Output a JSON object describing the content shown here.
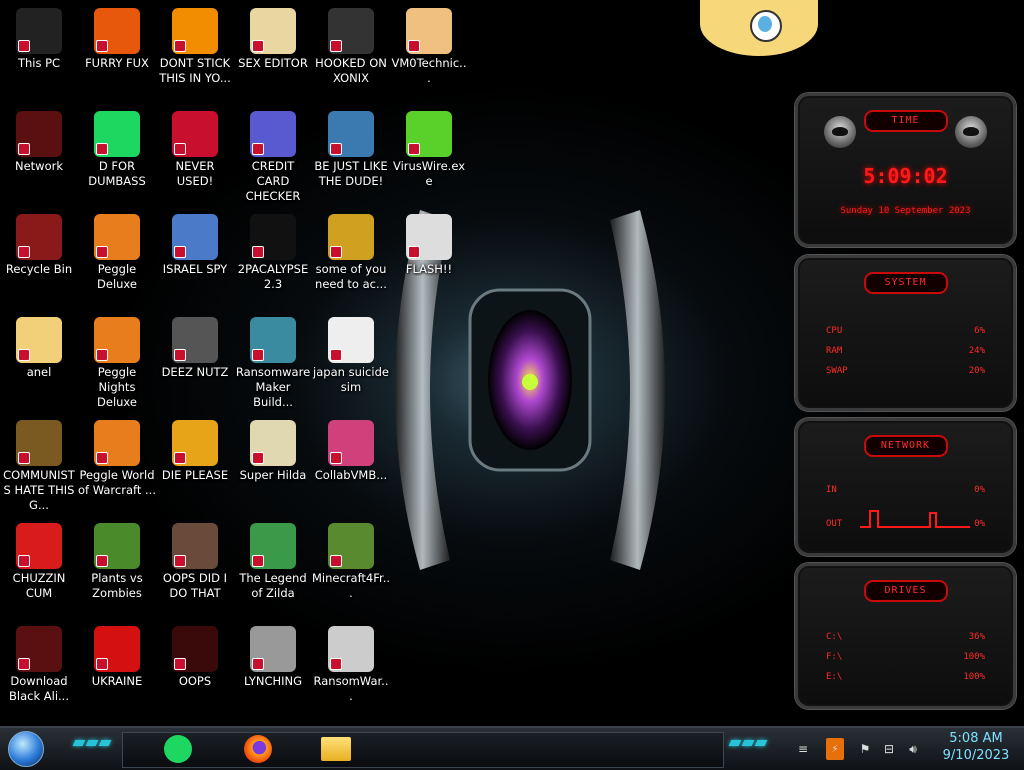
{
  "desktop": {
    "icons": [
      {
        "label": "This PC",
        "icon": "computer-icon",
        "color": "#222"
      },
      {
        "label": "Network",
        "icon": "alien-head-icon",
        "color": "#5a1010"
      },
      {
        "label": "Recycle Bin",
        "icon": "recycle-bin-icon",
        "color": "#8a1a1a"
      },
      {
        "label": "anel",
        "icon": "cartoon-girl-icon",
        "color": "#f2d07a"
      },
      {
        "label": "COMMUNISTS HATE THIS G...",
        "icon": "money-bag-icon",
        "color": "#7a5a20"
      },
      {
        "label": "CHUZZIN CUM",
        "icon": "red-furball-icon",
        "color": "#d81b1b"
      },
      {
        "label": "Download Black Ali...",
        "icon": "alien-head-icon",
        "color": "#5a1010"
      },
      {
        "label": "FURRY FUX",
        "icon": "firefox-icon",
        "color": "#e8580c"
      },
      {
        "label": "D FOR DUMBASS",
        "icon": "spotify-icon",
        "color": "#1ed760"
      },
      {
        "label": "Peggle Deluxe",
        "icon": "peggle-icon",
        "color": "#e87d1e"
      },
      {
        "label": "Peggle Nights Deluxe",
        "icon": "peggle-icon",
        "color": "#e87d1e"
      },
      {
        "label": "Peggle World of Warcraft ...",
        "icon": "peggle-icon",
        "color": "#e87d1e"
      },
      {
        "label": "Plants vs Zombies",
        "icon": "flower-pot-icon",
        "color": "#4a8a2a"
      },
      {
        "label": "UKRAINE",
        "icon": "radiation-icon",
        "color": "#d41010"
      },
      {
        "label": "DONT STICK THIS IN YO...",
        "icon": "traffic-cone-icon",
        "color": "#f28c00"
      },
      {
        "label": "NEVER USED!",
        "icon": "dev-cpp-icon",
        "color": "#c8102e"
      },
      {
        "label": "ISRAEL SPY",
        "icon": "network-pc-icon",
        "color": "#4a7ac8"
      },
      {
        "label": "DEEZ NUTZ",
        "icon": "stacked-windows-icon",
        "color": "#555"
      },
      {
        "label": "DIE PLEASE",
        "icon": "de-letters-icon",
        "color": "#e8a418"
      },
      {
        "label": "OOPS DID I DO THAT",
        "icon": "portrait-icon",
        "color": "#6a4a3a"
      },
      {
        "label": "OOPS",
        "icon": "alien-laptop-icon",
        "color": "#3a0a0a"
      },
      {
        "label": "SEX EDITOR",
        "icon": "hxd-icon",
        "color": "#e8d7a0"
      },
      {
        "label": "CREDIT CARD CHECKER",
        "icon": "credit-card-icon",
        "color": "#5a5ad0"
      },
      {
        "label": "2PACALYPSE 2.3",
        "icon": "terminal-icon",
        "color": "#111"
      },
      {
        "label": "Ransomware Maker Build...",
        "icon": "window-app-icon",
        "color": "#3a8aa0"
      },
      {
        "label": "Super Hilda",
        "icon": "pixel-dog-icon",
        "color": "#e0d8b0"
      },
      {
        "label": "The Legend of Zilda",
        "icon": "pixel-hero-icon",
        "color": "#3a9a4a"
      },
      {
        "label": "LYNCHING",
        "icon": "gear-flag-icon",
        "color": "#999"
      },
      {
        "label": "HOOKED ON XONIX",
        "icon": "maze-icon",
        "color": "#333"
      },
      {
        "label": "BE JUST LIKE THE DUDE!",
        "icon": "dwarf-icon",
        "color": "#3a7ab0"
      },
      {
        "label": "some of you need to ac...",
        "icon": "bear-icon",
        "color": "#d0a020"
      },
      {
        "label": "japan suicide sim",
        "icon": "document-icon",
        "color": "#eee"
      },
      {
        "label": "CollabVMB...",
        "icon": "pink-monitor-icon",
        "color": "#d0407a"
      },
      {
        "label": "Minecraft4Fr...",
        "icon": "grass-block-icon",
        "color": "#5a8a30"
      },
      {
        "label": "RansomWar...",
        "icon": "skull-ring-icon",
        "color": "#ccc"
      },
      {
        "label": "VM0Technic...",
        "icon": "doctor-icon",
        "color": "#f0c080"
      },
      {
        "label": "VirusWire.exe",
        "icon": "limewire-icon",
        "color": "#5ad02a"
      },
      {
        "label": "FLASH!!",
        "icon": "flash-doc-icon",
        "color": "#ddd"
      }
    ]
  },
  "gadgets": {
    "time": {
      "header": "TIME",
      "clock": "5:09:02",
      "date": "Sunday 10 September 2023"
    },
    "system": {
      "header": "SYSTEM",
      "rows": [
        {
          "label": "CPU",
          "value": "6%"
        },
        {
          "label": "RAM",
          "value": "24%"
        },
        {
          "label": "SWAP",
          "value": "20%"
        }
      ]
    },
    "network": {
      "header": "NETWORK",
      "rows": [
        {
          "label": "IN",
          "value": "0%"
        },
        {
          "label": "OUT",
          "value": "0%"
        }
      ]
    },
    "drives": {
      "header": "DRIVES",
      "rows": [
        {
          "label": "C:\\",
          "value": "36%"
        },
        {
          "label": "F:\\",
          "value": "100%"
        },
        {
          "label": "E:\\",
          "value": "100%"
        }
      ]
    }
  },
  "taskbar": {
    "pinned": [
      {
        "name": "spotify",
        "color": "#1ed760"
      },
      {
        "name": "firefox",
        "color": "#e8580c"
      },
      {
        "name": "file-explorer",
        "color": "#f0c040"
      }
    ],
    "clock": {
      "time": "5:08 AM",
      "date": "9/10/2023"
    }
  }
}
